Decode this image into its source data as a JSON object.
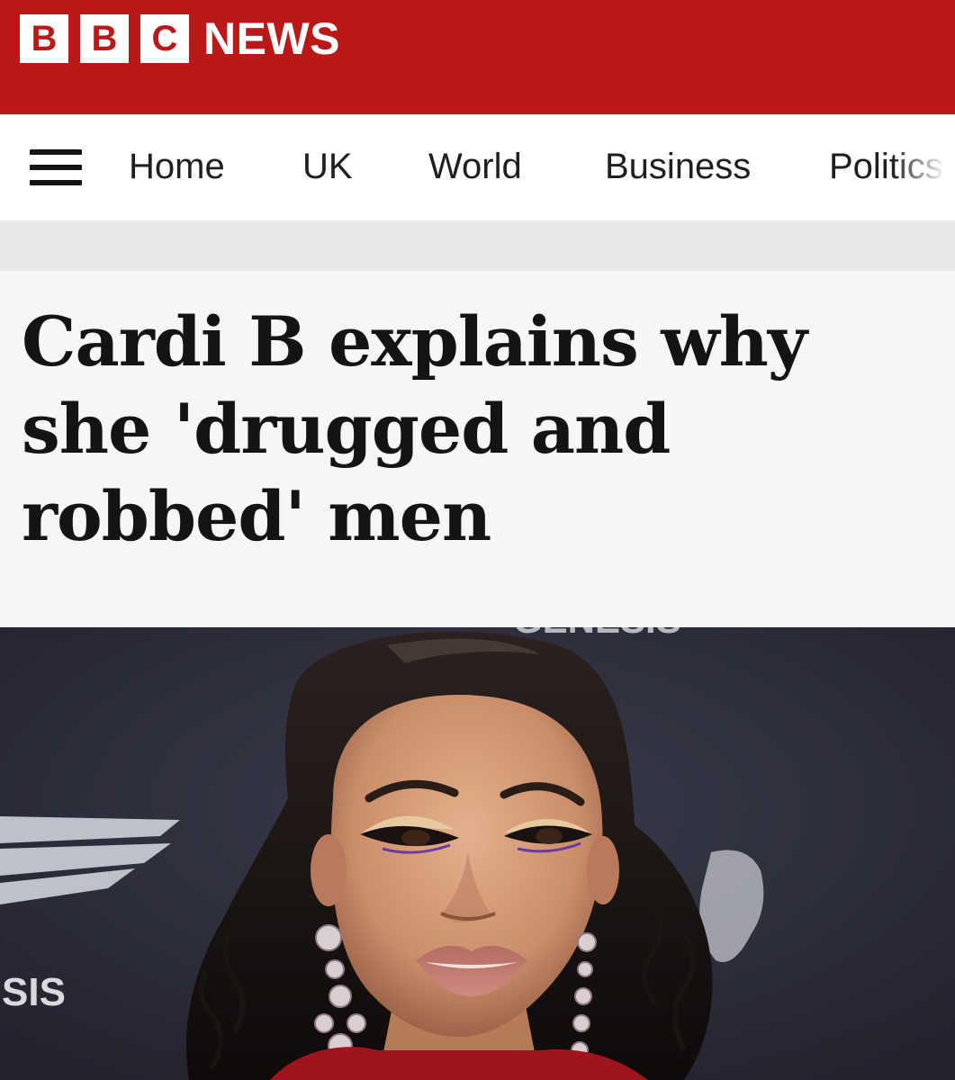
{
  "brand": {
    "logo_letters": [
      "B",
      "B",
      "C"
    ],
    "logo_text": "NEWS",
    "red": "#bb1919"
  },
  "nav": {
    "menu_icon": "hamburger-menu-icon",
    "items": [
      {
        "label": "Home"
      },
      {
        "label": "UK"
      },
      {
        "label": "World"
      },
      {
        "label": "Business"
      },
      {
        "label": "Politics"
      }
    ]
  },
  "article": {
    "headline_lines": [
      "Cardi B explains why",
      "she 'drugged and",
      "robbed' men"
    ]
  },
  "hero_image": {
    "backdrop_text_top": "GENESIS",
    "backdrop_text_left": "SIS"
  }
}
